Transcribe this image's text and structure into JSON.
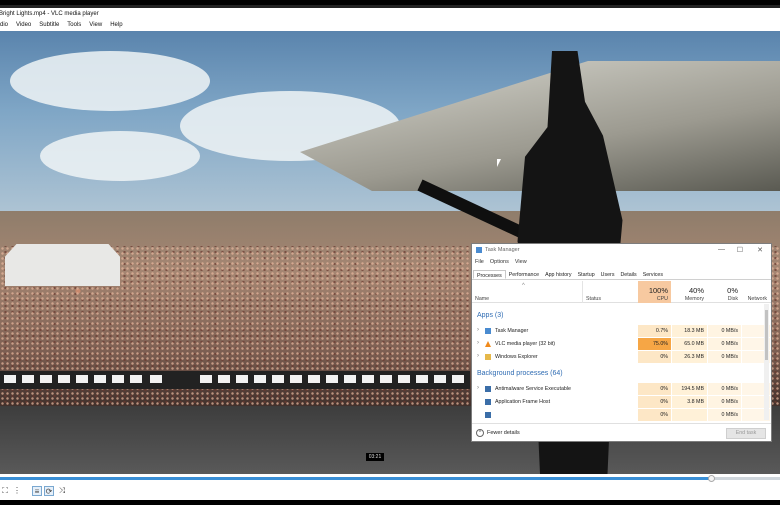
{
  "window": {
    "title": "Bright Lights.mp4 - VLC media player"
  },
  "menu": [
    "dio",
    "Video",
    "Subtitle",
    "Tools",
    "View",
    "Help"
  ],
  "player": {
    "timecode": "03:21",
    "progress_fraction": 0.913
  },
  "task_manager": {
    "title": "Task Manager",
    "menu": [
      "File",
      "Options",
      "View"
    ],
    "tabs": [
      "Processes",
      "Performance",
      "App history",
      "Startup",
      "Users",
      "Details",
      "Services"
    ],
    "active_tab": "Processes",
    "columns": {
      "name": "Name",
      "status": "Status",
      "cpu_pct": "100%",
      "cpu": "CPU",
      "mem_pct": "40%",
      "mem": "Memory",
      "disk_pct": "0%",
      "disk": "Disk",
      "net": "Network"
    },
    "groups": {
      "apps": "Apps (3)",
      "background": "Background processes (64)"
    },
    "apps": [
      {
        "name": "Task Manager",
        "cpu": "0.7%",
        "mem": "18.3 MB",
        "disk": "0 MB/s",
        "net": "0"
      },
      {
        "name": "VLC media player (32 bit)",
        "cpu": "75.0%",
        "mem": "65.0 MB",
        "disk": "0 MB/s",
        "net": "0"
      },
      {
        "name": "Windows Explorer",
        "cpu": "0%",
        "mem": "26.3 MB",
        "disk": "0 MB/s",
        "net": "0"
      }
    ],
    "background": [
      {
        "name": "Antimalware Service Executable",
        "cpu": "0%",
        "mem": "194.5 MB",
        "disk": "0 MB/s",
        "net": "0"
      },
      {
        "name": "Application Frame Host",
        "cpu": "0%",
        "mem": "3.8 MB",
        "disk": "0 MB/s",
        "net": "0"
      },
      {
        "name": "",
        "cpu": "0%",
        "mem": "",
        "disk": "0 MB/s",
        "net": "0"
      }
    ],
    "footer": {
      "fewer_details": "Fewer details",
      "end_task": "End task"
    }
  },
  "colors": {
    "seek_fill": "#3a8fd6",
    "cpu_hot": "#f6a645",
    "group_text": "#2f6cb3"
  }
}
